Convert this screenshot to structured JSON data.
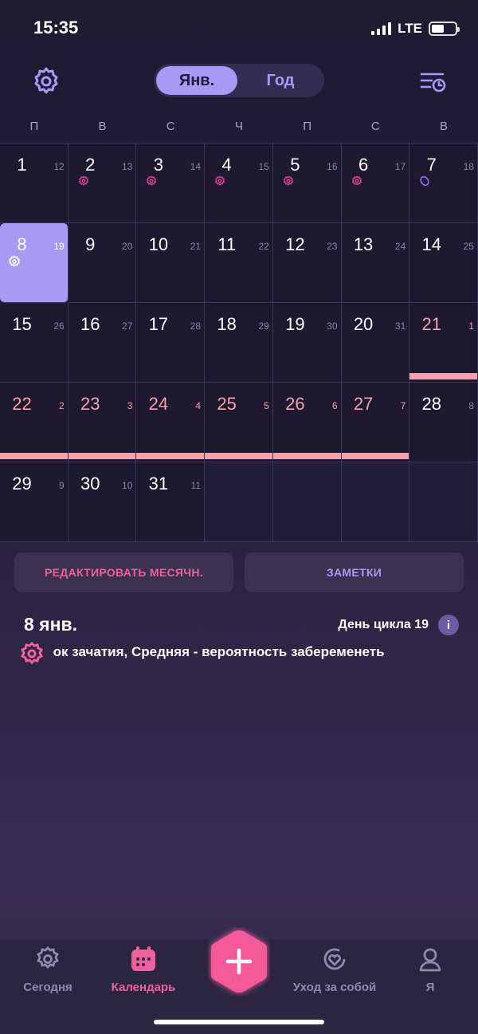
{
  "status": {
    "time": "15:35",
    "network": "LTE"
  },
  "header": {
    "segment_month": "Янв.",
    "segment_year": "Год"
  },
  "weekdays": [
    "П",
    "В",
    "С",
    "Ч",
    "П",
    "С",
    "В"
  ],
  "calendar": {
    "rows": [
      [
        {
          "d": "1",
          "c": "12"
        },
        {
          "d": "2",
          "c": "13",
          "ovu": true
        },
        {
          "d": "3",
          "c": "14",
          "ovu": true
        },
        {
          "d": "4",
          "c": "15",
          "ovu": true
        },
        {
          "d": "5",
          "c": "16",
          "ovu": true
        },
        {
          "d": "6",
          "c": "17",
          "ovu": true
        },
        {
          "d": "7",
          "c": "18",
          "egg": true
        }
      ],
      [
        {
          "d": "8",
          "c": "19",
          "selected": true
        },
        {
          "d": "9",
          "c": "20"
        },
        {
          "d": "10",
          "c": "21"
        },
        {
          "d": "11",
          "c": "22"
        },
        {
          "d": "12",
          "c": "23"
        },
        {
          "d": "13",
          "c": "24"
        },
        {
          "d": "14",
          "c": "25"
        }
      ],
      [
        {
          "d": "15",
          "c": "26"
        },
        {
          "d": "16",
          "c": "27"
        },
        {
          "d": "17",
          "c": "28"
        },
        {
          "d": "18",
          "c": "29"
        },
        {
          "d": "19",
          "c": "30"
        },
        {
          "d": "20",
          "c": "31"
        },
        {
          "d": "21",
          "c": "1",
          "period": true
        }
      ],
      [
        {
          "d": "22",
          "c": "2",
          "period": true
        },
        {
          "d": "23",
          "c": "3",
          "period": true
        },
        {
          "d": "24",
          "c": "4",
          "period": true
        },
        {
          "d": "25",
          "c": "5",
          "period": true
        },
        {
          "d": "26",
          "c": "6",
          "period": true
        },
        {
          "d": "27",
          "c": "7",
          "period": true
        },
        {
          "d": "28",
          "c": "8"
        }
      ],
      [
        {
          "d": "29",
          "c": "9"
        },
        {
          "d": "30",
          "c": "10"
        },
        {
          "d": "31",
          "c": "11"
        },
        null,
        null,
        null,
        null
      ]
    ]
  },
  "actions": {
    "edit_label": "РЕДАКТИРОВАТЬ МЕСЯЧН.",
    "notes_label": "ЗАМЕТКИ"
  },
  "selected_day": {
    "title": "8 янв.",
    "cycle_day": "День цикла 19",
    "info": "i",
    "fertility_text": "Срок зачатия, Средняя - вероятность забеременеть"
  },
  "tabs": {
    "today": "Сегодня",
    "calendar": "Календарь",
    "selfcare": "Уход за собой",
    "me": "Я"
  },
  "colors": {
    "accent": "#a899f5",
    "pink": "#ee5f9e",
    "period": "#f4a1ab"
  }
}
